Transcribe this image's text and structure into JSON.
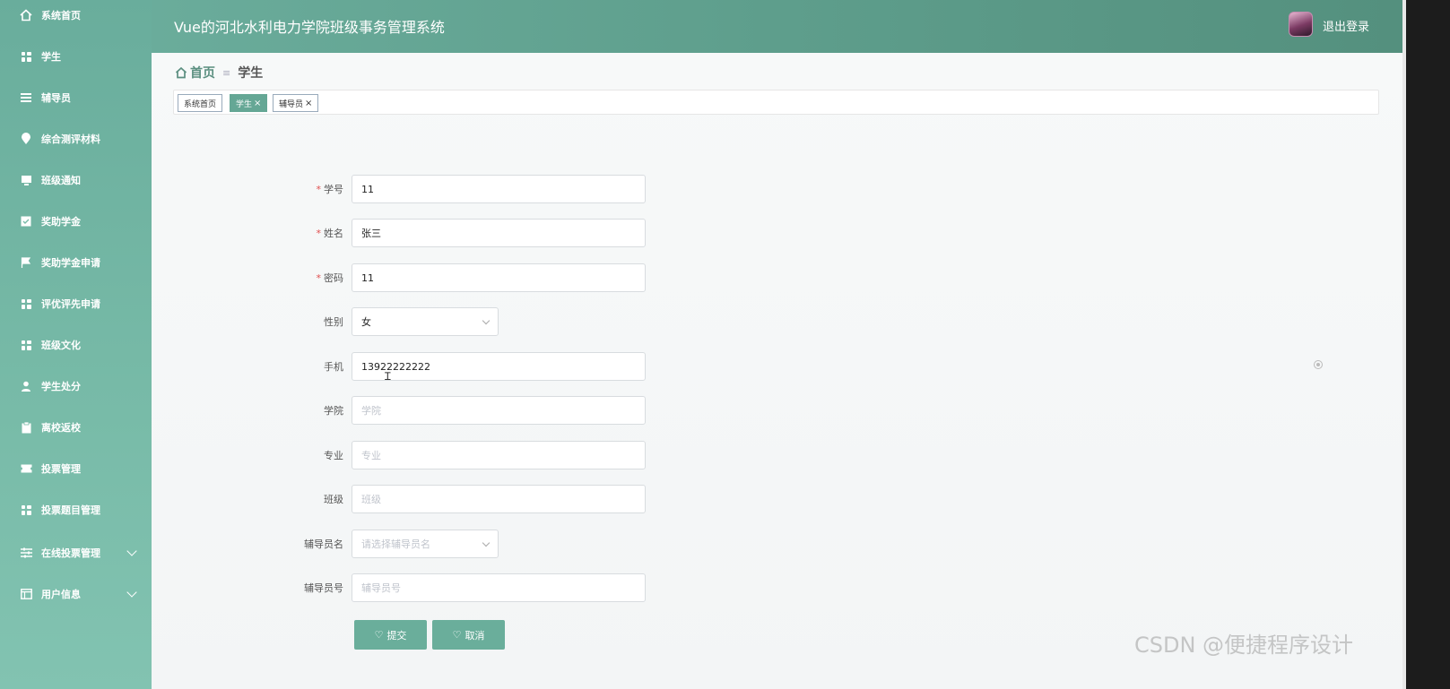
{
  "app": {
    "title": "Vue的河北水利电力学院班级事务管理系统",
    "logout_label": "退出登录"
  },
  "sidebar": {
    "items": [
      {
        "label": "系统首页",
        "icon": "home-icon"
      },
      {
        "label": "学生",
        "icon": "grid-icon"
      },
      {
        "label": "辅导员",
        "icon": "list-icon"
      },
      {
        "label": "综合测评材料",
        "icon": "location-icon"
      },
      {
        "label": "班级通知",
        "icon": "monitor-icon"
      },
      {
        "label": "奖助学金",
        "icon": "checkbox-icon"
      },
      {
        "label": "奖助学金申请",
        "icon": "flag-icon"
      },
      {
        "label": "评优评先申请",
        "icon": "grid-icon"
      },
      {
        "label": "班级文化",
        "icon": "grid-icon"
      },
      {
        "label": "学生处分",
        "icon": "user-icon"
      },
      {
        "label": "离校返校",
        "icon": "clipboard-icon"
      },
      {
        "label": "投票管理",
        "icon": "ticket-icon"
      },
      {
        "label": "投票题目管理",
        "icon": "grid-icon"
      },
      {
        "label": "在线投票管理",
        "icon": "sliders-icon",
        "expandable": true
      },
      {
        "label": "用户信息",
        "icon": "window-icon",
        "expandable": true
      }
    ]
  },
  "breadcrumb": {
    "home": "首页",
    "separator": "≡",
    "current": "学生"
  },
  "tags": [
    {
      "label": "系统首页",
      "active": false,
      "closable": false
    },
    {
      "label": "学生",
      "active": true,
      "closable": true
    },
    {
      "label": "辅导员",
      "active": false,
      "closable": true
    }
  ],
  "tag_close_glyph": "×",
  "form": {
    "fields": [
      {
        "label": "学号",
        "required": true,
        "value": "11",
        "placeholder": "",
        "type": "text"
      },
      {
        "label": "姓名",
        "required": true,
        "value": "张三",
        "placeholder": "",
        "type": "text"
      },
      {
        "label": "密码",
        "required": true,
        "value": "11",
        "placeholder": "",
        "type": "text"
      },
      {
        "label": "性别",
        "required": false,
        "value": "女",
        "placeholder": "",
        "type": "select"
      },
      {
        "label": "手机",
        "required": false,
        "value": "13922222222",
        "placeholder": "",
        "type": "text"
      },
      {
        "label": "学院",
        "required": false,
        "value": "",
        "placeholder": "学院",
        "type": "text"
      },
      {
        "label": "专业",
        "required": false,
        "value": "",
        "placeholder": "专业",
        "type": "text"
      },
      {
        "label": "班级",
        "required": false,
        "value": "",
        "placeholder": "班级",
        "type": "text"
      },
      {
        "label": "辅导员名",
        "required": false,
        "value": "",
        "placeholder": "请选择辅导员名",
        "type": "select"
      },
      {
        "label": "辅导员号",
        "required": false,
        "value": "",
        "placeholder": "辅导员号",
        "type": "text"
      }
    ],
    "submit_label": "提交",
    "cancel_label": "取消",
    "required_mark": "*"
  },
  "watermark": "CSDN @便捷程序设计",
  "colors": {
    "accent": "#6aae9b",
    "sidebar": "#78bba8",
    "header": "#5e9e8c"
  }
}
